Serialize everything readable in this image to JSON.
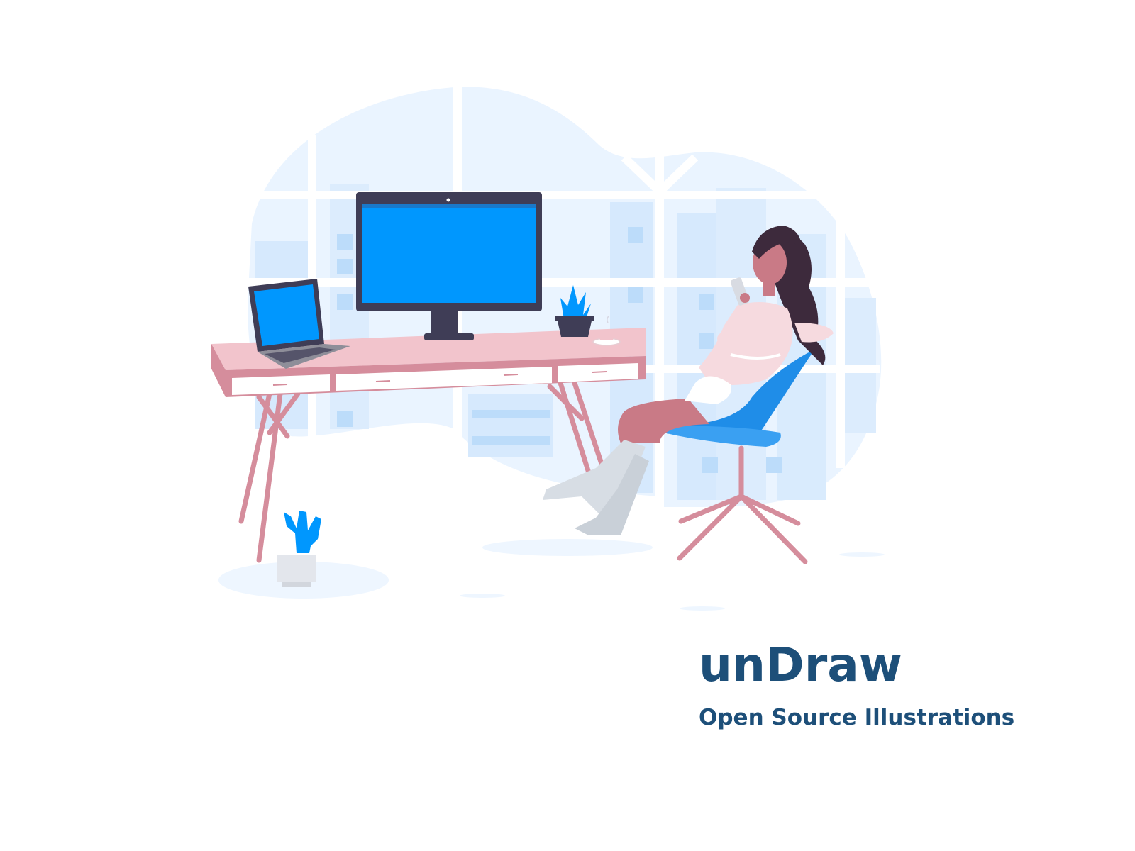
{
  "brand": {
    "title": "unDraw",
    "tagline": "Open Source Illustrations"
  },
  "colors": {
    "background": "#ffffff",
    "brand_text": "#1d4f79",
    "accent_blue": "#0097fe",
    "blob_light": "#eaf4ff",
    "desk_pink": "#d58d9c",
    "monitor_dark": "#3f3d56",
    "hair": "#3d2a3c"
  },
  "illustration": {
    "subject": "woman relaxing on office chair next to desk with monitor and laptop",
    "icons": [
      "monitor-icon",
      "laptop-icon",
      "plant-icon",
      "cactus-icon",
      "coffee-cup-icon",
      "office-chair-icon",
      "phone-icon"
    ]
  }
}
